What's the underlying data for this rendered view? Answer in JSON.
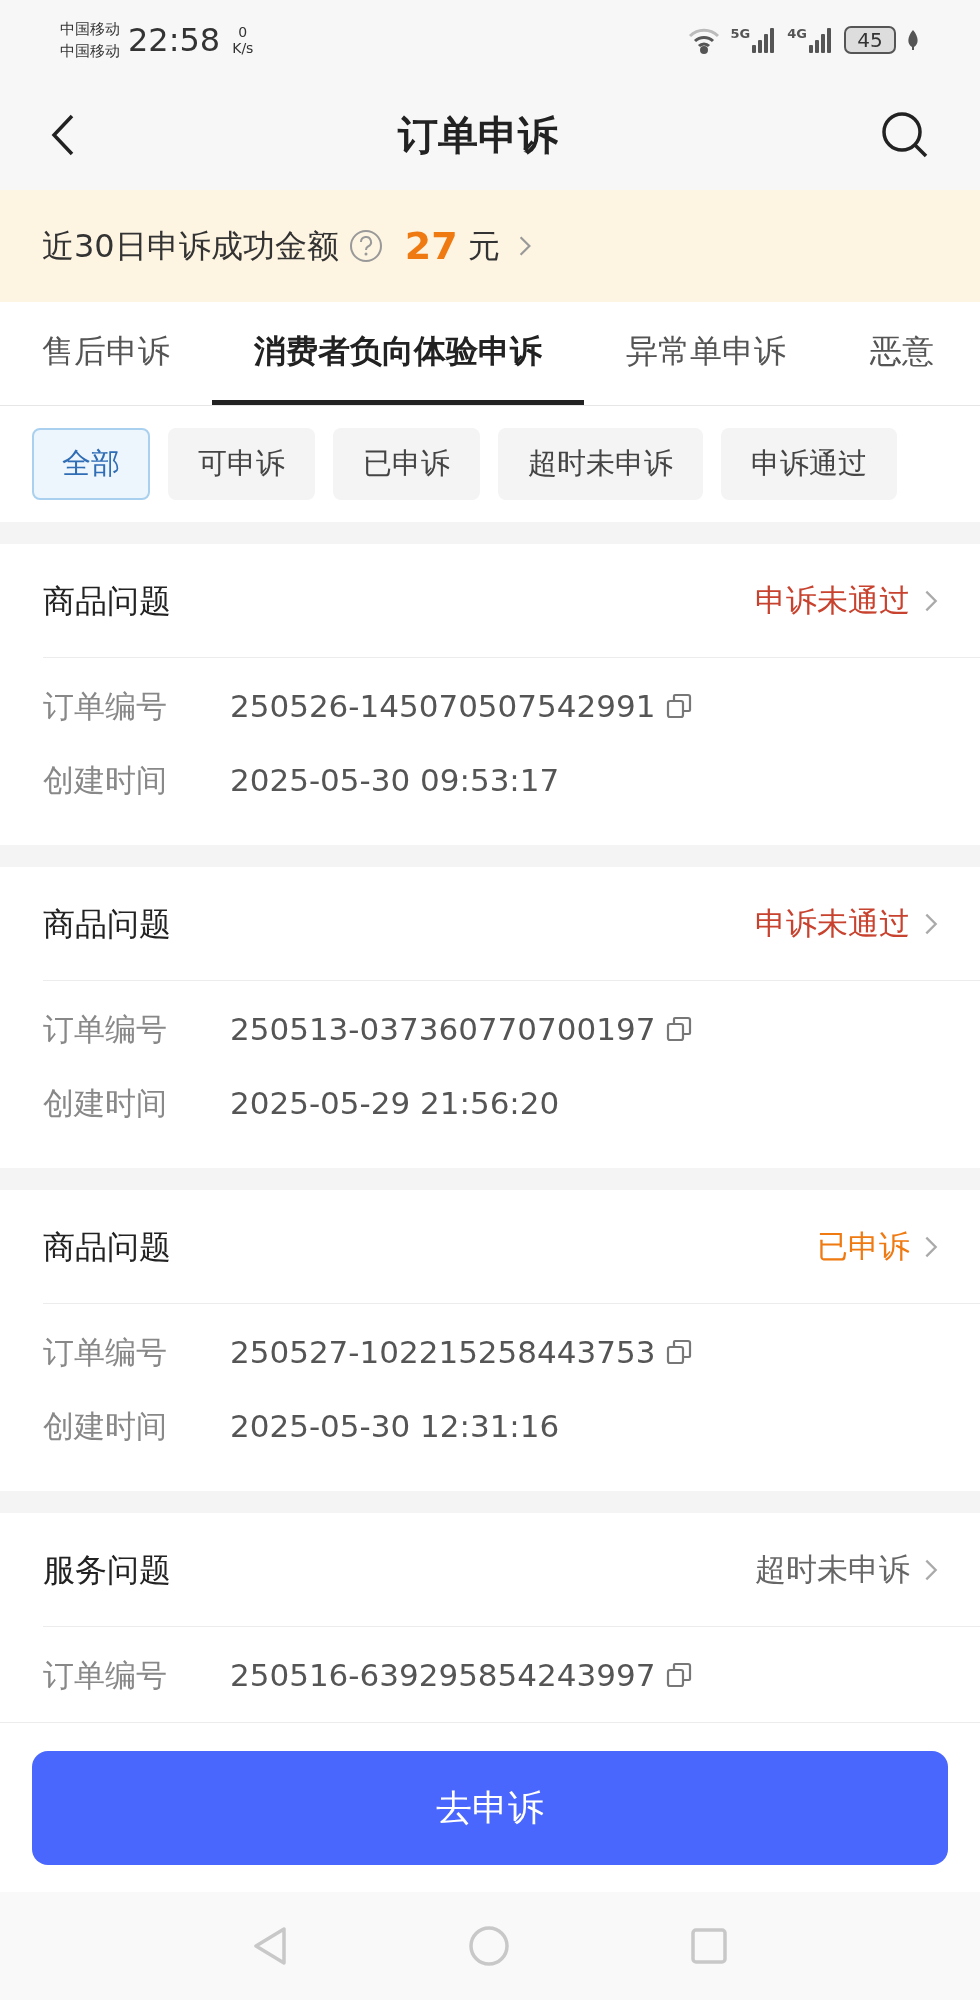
{
  "status_bar": {
    "carriers": [
      "中国移动",
      "中国移动"
    ],
    "time": "22:58",
    "speed_value": "0",
    "speed_unit": "K/s",
    "networks": [
      "5G",
      "4G"
    ],
    "battery": "45"
  },
  "header": {
    "title": "订单申诉"
  },
  "banner": {
    "label": "近30日申诉成功金额",
    "amount": "27",
    "unit": "元"
  },
  "tabs": [
    {
      "label": "售后申诉",
      "selected": false
    },
    {
      "label": "消费者负向体验申诉",
      "selected": true
    },
    {
      "label": "异常单申诉",
      "selected": false
    },
    {
      "label": "恶意",
      "selected": false
    }
  ],
  "filters": [
    {
      "label": "全部",
      "selected": true
    },
    {
      "label": "可申诉",
      "selected": false
    },
    {
      "label": "已申诉",
      "selected": false
    },
    {
      "label": "超时未申诉",
      "selected": false
    },
    {
      "label": "申诉通过",
      "selected": false
    }
  ],
  "cards": [
    {
      "type": "商品问题",
      "status": "申诉未通过",
      "kind": "rejected",
      "fields": [
        {
          "label": "订单编号",
          "value": "250526-145070507542991",
          "copyable": true
        },
        {
          "label": "创建时间",
          "value": "2025-05-30 09:53:17",
          "copyable": false
        }
      ]
    },
    {
      "type": "商品问题",
      "status": "申诉未通过",
      "kind": "rejected",
      "fields": [
        {
          "label": "订单编号",
          "value": "250513-037360770700197",
          "copyable": true
        },
        {
          "label": "创建时间",
          "value": "2025-05-29 21:56:20",
          "copyable": false
        }
      ]
    },
    {
      "type": "商品问题",
      "status": "已申诉",
      "kind": "submitted",
      "fields": [
        {
          "label": "订单编号",
          "value": "250527-102215258443753",
          "copyable": true
        },
        {
          "label": "创建时间",
          "value": "2025-05-30 12:31:16",
          "copyable": false
        }
      ]
    },
    {
      "type": "服务问题",
      "status": "超时未申诉",
      "kind": "expired",
      "fields": [
        {
          "label": "订单编号",
          "value": "250516-639295854243997",
          "copyable": true
        }
      ]
    }
  ],
  "action_button": "去申诉"
}
